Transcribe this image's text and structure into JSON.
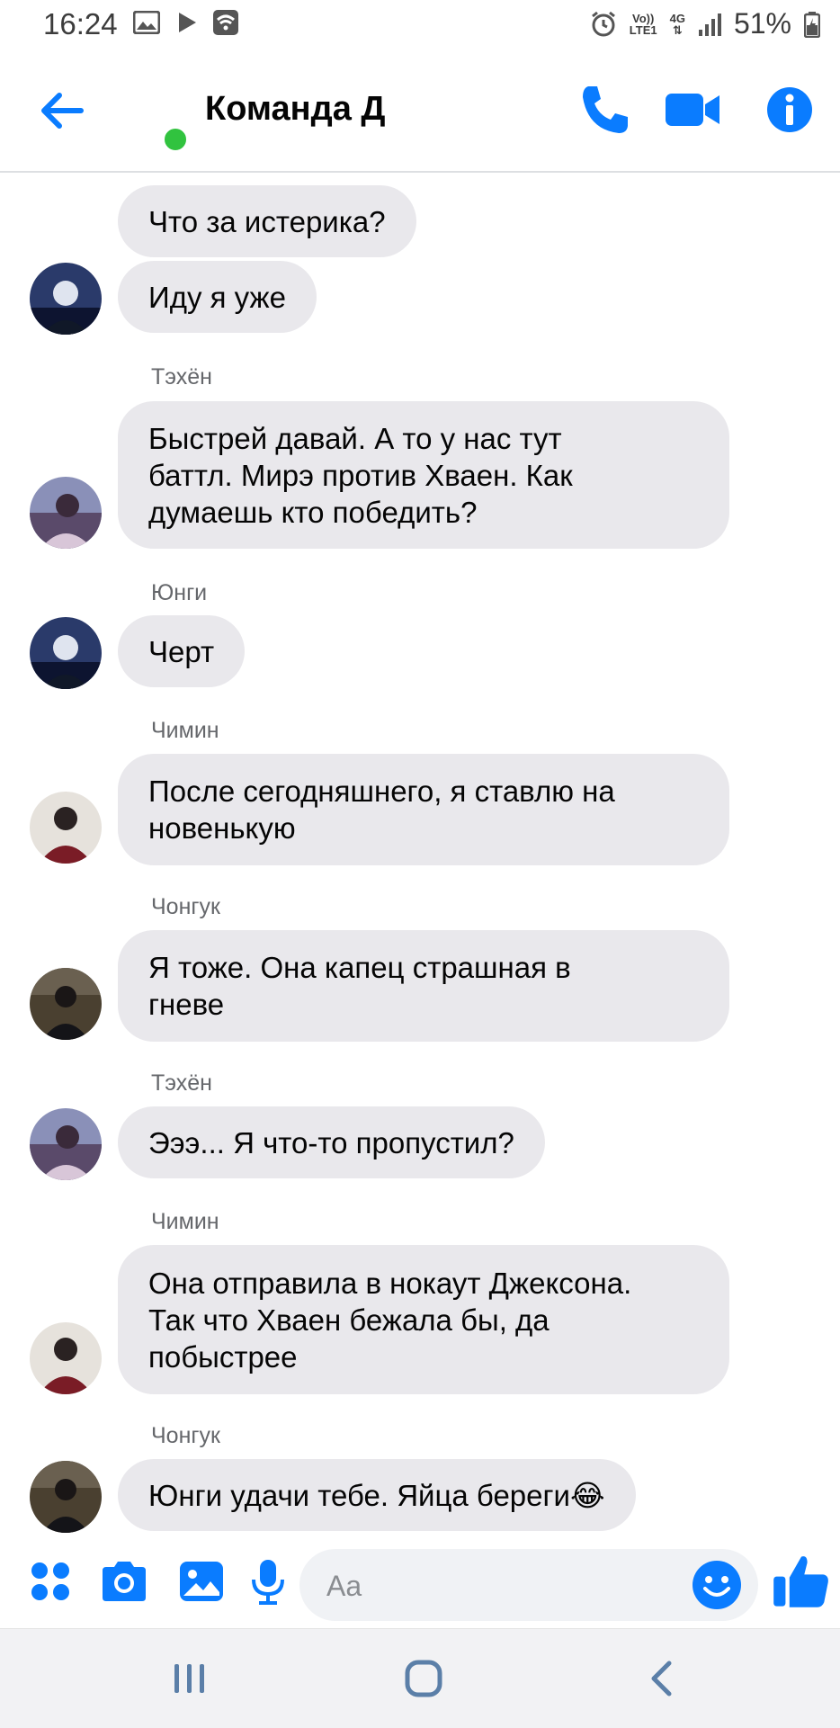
{
  "status_bar": {
    "time": "16:24",
    "network_top": "Vo))",
    "network_bottom": "LTE1",
    "net_type": "4G",
    "battery": "51%"
  },
  "header": {
    "title": "Команда Д",
    "accent": "#0a7cff"
  },
  "messages": [
    {
      "sender": "",
      "text": "Что за истерика?"
    },
    {
      "sender": "",
      "text": "Иду я уже"
    },
    {
      "sender": "Тэхён",
      "text": "Быстрей давай. А то у нас тут\nбаттл. Мирэ против Хваен. Как\nдумаешь кто победить?"
    },
    {
      "sender": "Юнги",
      "text": "Черт"
    },
    {
      "sender": "Чимин",
      "text": "После сегодняшнего, я ставлю на\nновенькую"
    },
    {
      "sender": "Чонгук",
      "text": "Я тоже. Она капец страшная в\nгневе"
    },
    {
      "sender": "Тэхён",
      "text": "Эээ... Я что-то пропустил?"
    },
    {
      "sender": "Чимин",
      "text": "Она отправила в нокаут Джексона.\nТак что Хваен бежала бы, да\nпобыстрее"
    },
    {
      "sender": "Чонгук",
      "text": "Юнги удачи тебе. Яйца береги😂"
    }
  ],
  "composer": {
    "placeholder": "Aa"
  },
  "icons": {
    "back": "arrow-left-icon",
    "call": "phone-icon",
    "video": "video-camera-icon",
    "info": "info-icon",
    "menu": "four-dots-icon",
    "camera": "camera-icon",
    "gallery": "image-icon",
    "mic": "microphone-icon",
    "emoji": "smiley-icon",
    "like": "thumbs-up-icon"
  }
}
